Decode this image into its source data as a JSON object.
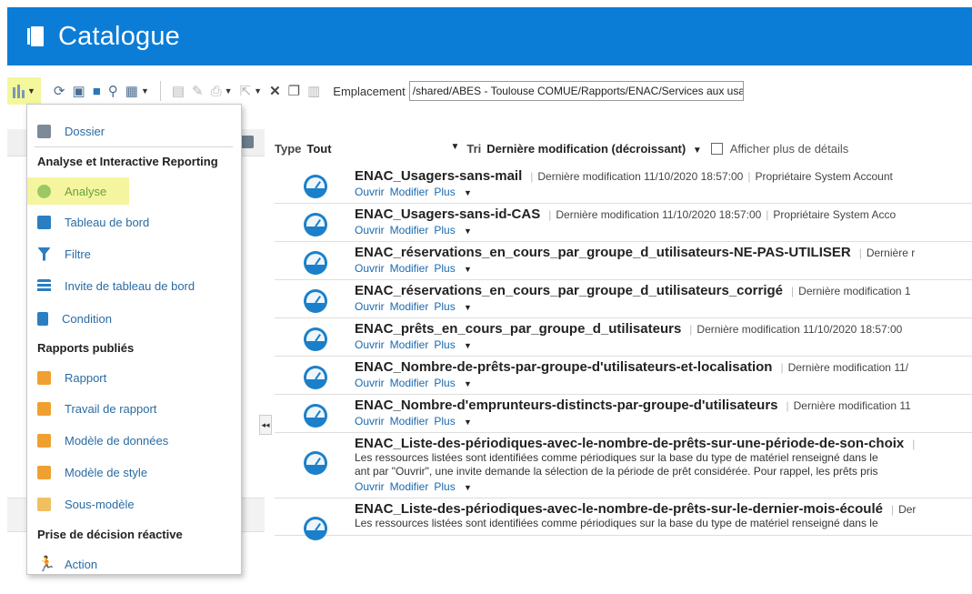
{
  "app": {
    "title": "Catalogue"
  },
  "toolbar": {
    "location_label": "Emplacement",
    "location_value": "/shared/ABES - Toulouse COMUE/Rapports/ENAC/Services aux usag"
  },
  "filters": {
    "type_label": "Type",
    "type_value": "Tout",
    "sort_label": "Tri",
    "sort_value": "Dernière modification (décroissant)",
    "details_label": "Afficher plus de détails"
  },
  "items": [
    {
      "name": "ENAC_Usagers-sans-mail",
      "meta": "Dernière modification 11/10/2020 18:57:00",
      "owner": "Propriétaire System Account"
    },
    {
      "name": "ENAC_Usagers-sans-id-CAS",
      "meta": "Dernière modification 11/10/2020 18:57:00",
      "owner": "Propriétaire System Acco"
    },
    {
      "name": "ENAC_réservations_en_cours_par_groupe_d_utilisateurs-NE-PAS-UTILISER",
      "meta": "Dernière r",
      "owner": ""
    },
    {
      "name": "ENAC_réservations_en_cours_par_groupe_d_utilisateurs_corrigé",
      "meta": "Dernière modification 1",
      "owner": ""
    },
    {
      "name": "ENAC_prêts_en_cours_par_groupe_d_utilisateurs",
      "meta": "Dernière modification 11/10/2020 18:57:00",
      "owner": ""
    },
    {
      "name": "ENAC_Nombre-de-prêts-par-groupe-d'utilisateurs-et-localisation",
      "meta": "Dernière modification 11/",
      "owner": ""
    },
    {
      "name": "ENAC_Nombre-d'emprunteurs-distincts-par-groupe-d'utilisateurs",
      "meta": "Dernière modification 11",
      "owner": ""
    },
    {
      "name": "ENAC_Liste-des-périodiques-avec-le-nombre-de-prêts-sur-une-période-de-son-choix",
      "meta": "",
      "owner": "",
      "desc1": "Les ressources listées sont identifiées comme périodiques sur la base du type de matériel renseigné dans le",
      "desc2": "ant par \"Ouvrir\", une invite demande la sélection de la période de prêt considérée. Pour rappel, les prêts pris"
    },
    {
      "name": "ENAC_Liste-des-périodiques-avec-le-nombre-de-prêts-sur-le-dernier-mois-écoulé",
      "meta": "Der",
      "owner": "",
      "desc1": "Les ressources listées sont identifiées comme périodiques sur la base du type de matériel renseigné dans le"
    }
  ],
  "item_actions": {
    "open": "Ouvrir",
    "edit": "Modifier",
    "more": "Plus"
  },
  "new_menu": {
    "folder": "Dossier",
    "section_analysis": "Analyse et Interactive Reporting",
    "analysis": "Analyse",
    "dashboard": "Tableau de bord",
    "filter": "Filtre",
    "dashboard_prompt": "Invite de tableau de bord",
    "condition": "Condition",
    "section_published": "Rapports publiés",
    "report": "Rapport",
    "report_job": "Travail de rapport",
    "data_model": "Modèle de données",
    "style_template": "Modèle de style",
    "sub_template": "Sous-modèle",
    "section_decision": "Prise de décision réactive",
    "action": "Action"
  },
  "colors": {
    "brand": "#0b7dd7",
    "highlight": "#f4f79b",
    "link": "#1a6ab0"
  }
}
